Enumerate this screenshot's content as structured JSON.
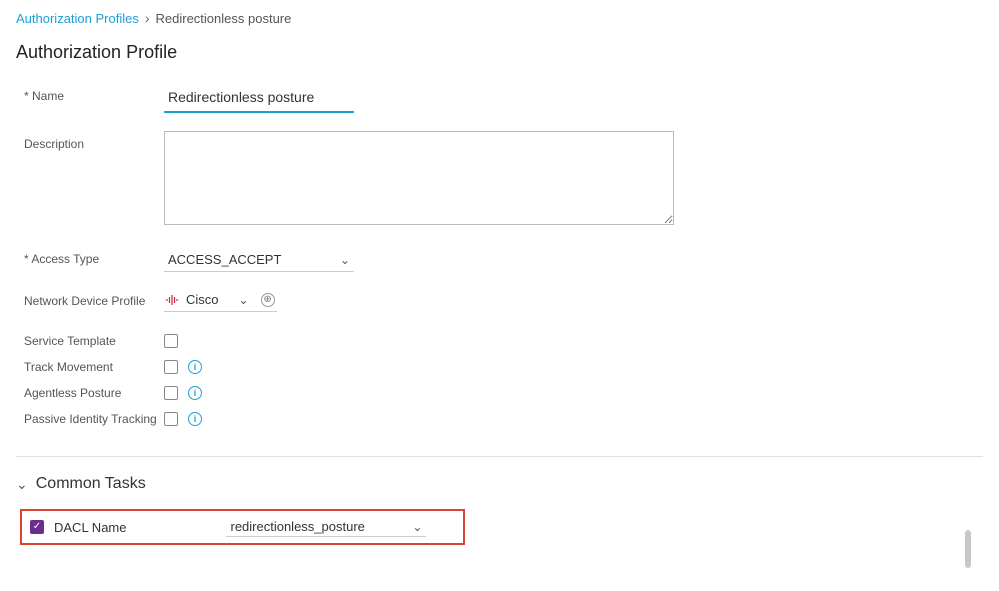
{
  "breadcrumb": {
    "parent": "Authorization Profiles",
    "current": "Redirectionless posture"
  },
  "page_title": "Authorization Profile",
  "fields": {
    "name_label": "* Name",
    "name_value": "Redirectionless posture",
    "description_label": "Description",
    "description_value": "",
    "access_type_label": "* Access Type",
    "access_type_value": "ACCESS_ACCEPT",
    "ndp_label": "Network Device Profile",
    "ndp_value": "Cisco",
    "service_template_label": "Service Template",
    "track_movement_label": "Track Movement",
    "agentless_posture_label": "Agentless Posture",
    "passive_identity_label": "Passive Identity Tracking"
  },
  "common_tasks": {
    "title": "Common Tasks",
    "dacl_label": "DACL Name",
    "dacl_value": "redirectionless_posture"
  }
}
